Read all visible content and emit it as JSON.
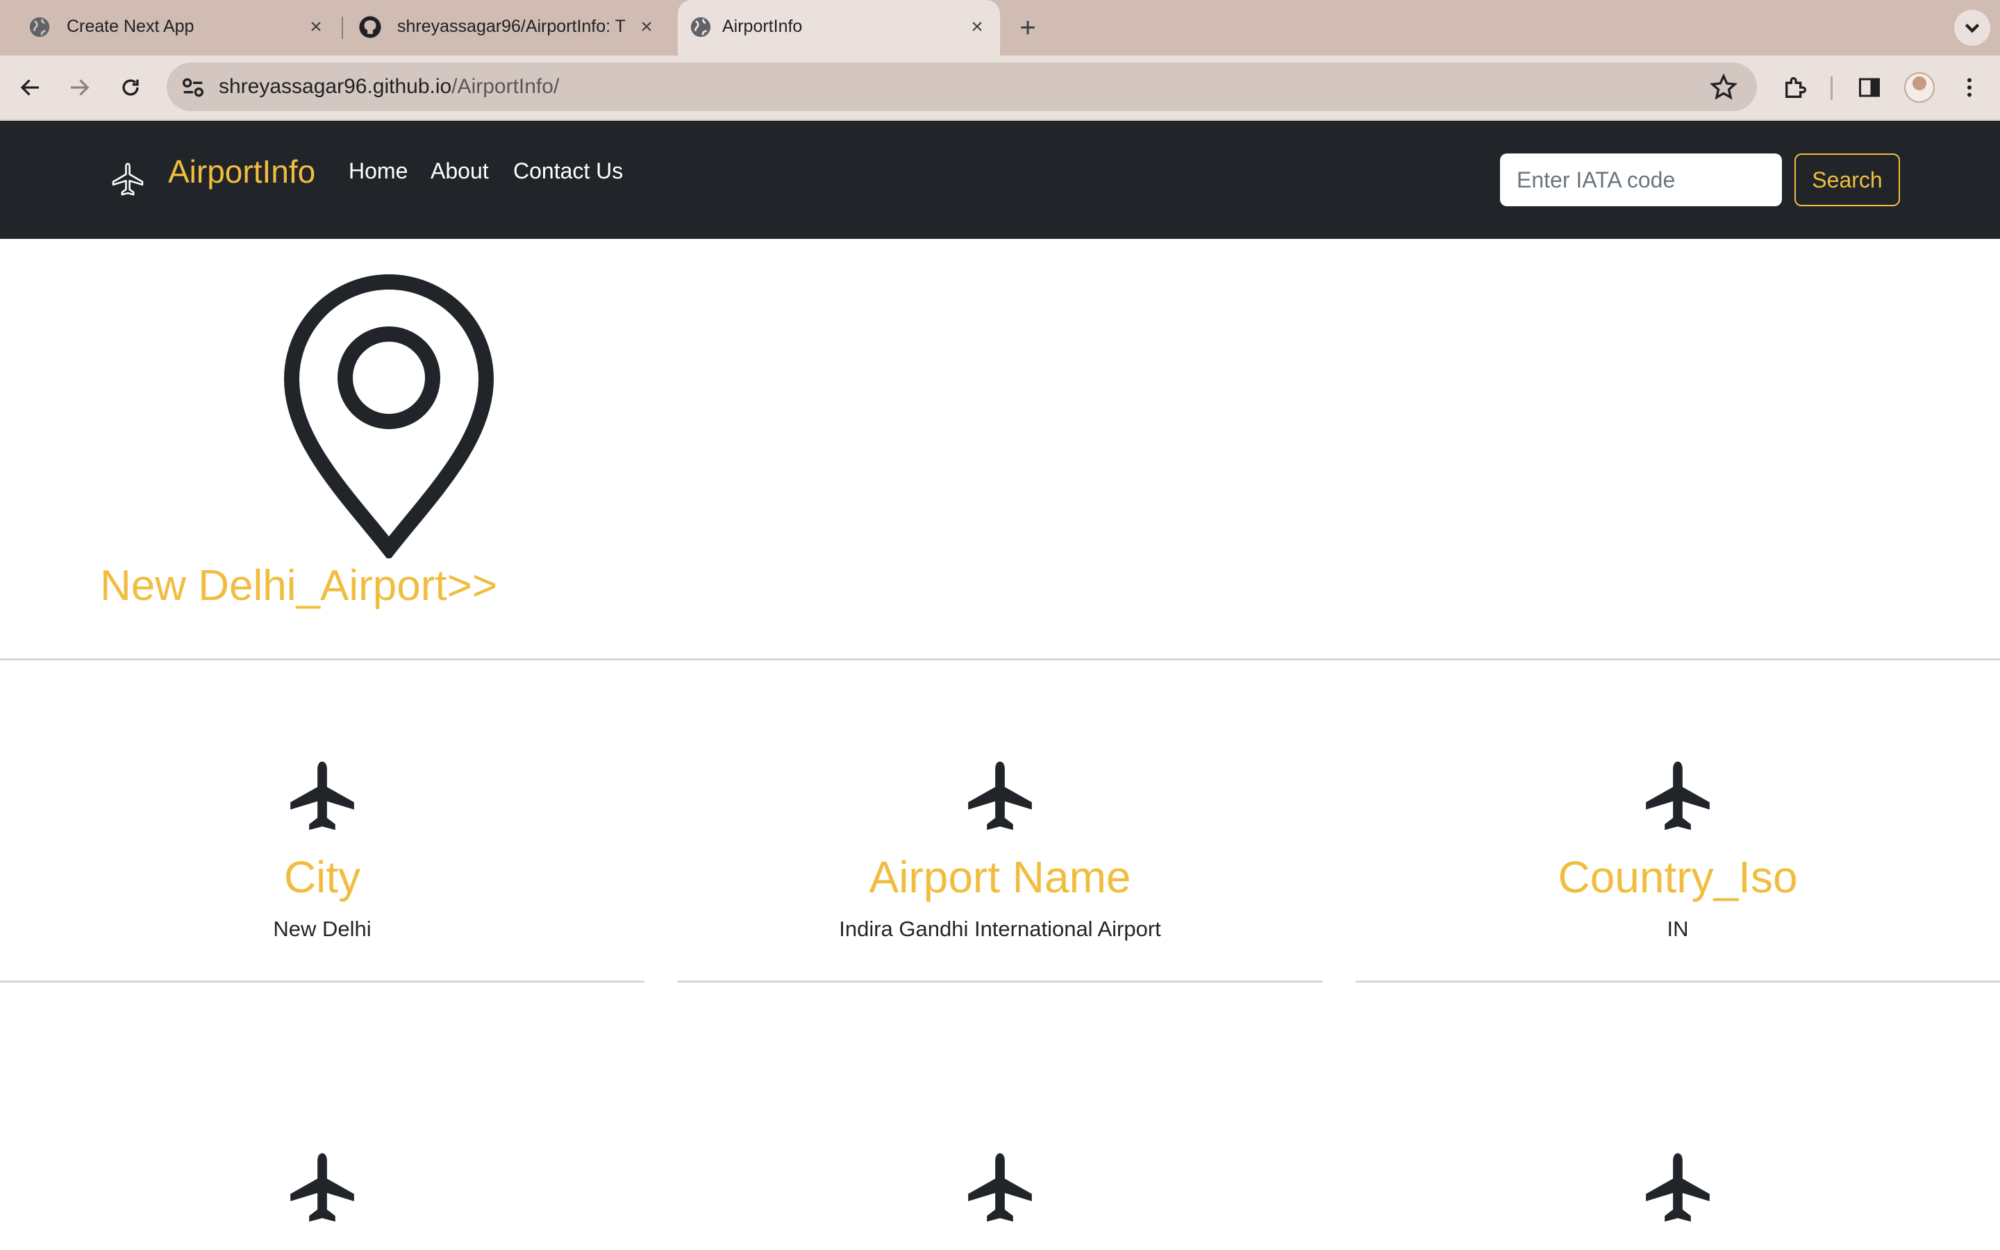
{
  "browser": {
    "tabs": [
      {
        "title": "Create Next App",
        "icon": "globe-icon",
        "active": false
      },
      {
        "title": "shreyassagar96/AirportInfo: T",
        "icon": "github-icon",
        "active": false
      },
      {
        "title": "AirportInfo",
        "icon": "globe-icon",
        "active": true
      }
    ],
    "url_host": "shreyassagar96.github.io",
    "url_path": "/AirportInfo/"
  },
  "site": {
    "brand": "AirportInfo",
    "brand_icon": "airplane-outline-icon",
    "nav": [
      {
        "label": "Home"
      },
      {
        "label": "About"
      },
      {
        "label": "Contact Us"
      }
    ],
    "search": {
      "placeholder": "Enter IATA code",
      "value": "",
      "button_label": "Search"
    },
    "accent_color": "#f0bd3f",
    "navbar_color": "#212529"
  },
  "hero": {
    "icon": "map-pin-icon",
    "title": "New Delhi_Airport>>"
  },
  "cards": [
    {
      "icon": "airplane-icon",
      "label": "City",
      "value": "New Delhi"
    },
    {
      "icon": "airplane-icon",
      "label": "Airport Name",
      "value": "Indira Gandhi International Airport"
    },
    {
      "icon": "airplane-icon",
      "label": "Country_Iso",
      "value": "IN"
    },
    {
      "icon": "airplane-icon",
      "label": "",
      "value": ""
    },
    {
      "icon": "airplane-icon",
      "label": "",
      "value": ""
    },
    {
      "icon": "airplane-icon",
      "label": "",
      "value": ""
    }
  ]
}
